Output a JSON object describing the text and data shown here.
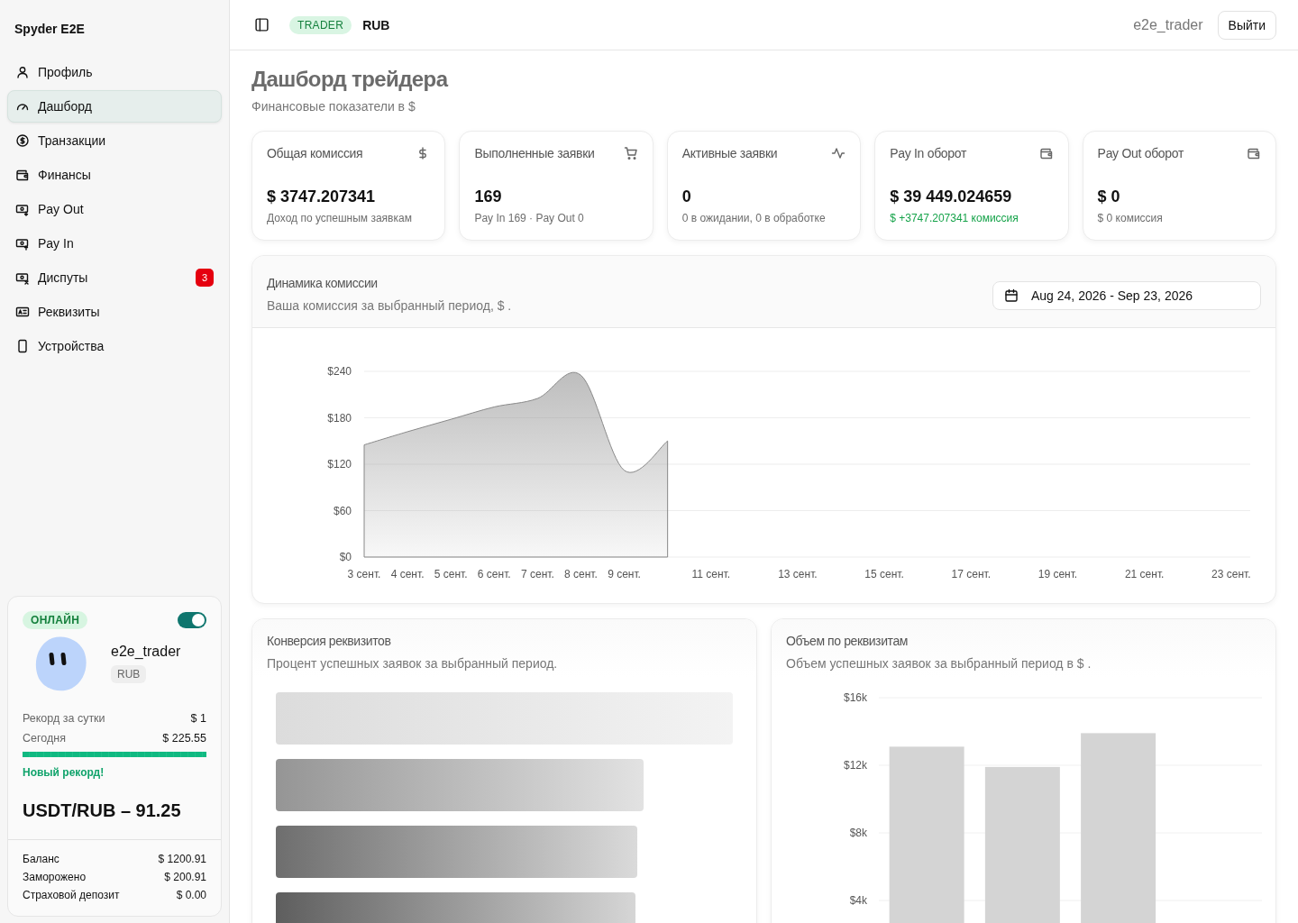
{
  "sidebar": {
    "brand": "Spyder E2E",
    "items": [
      {
        "label": "Профиль",
        "selected": false
      },
      {
        "label": "Дашборд",
        "selected": true
      },
      {
        "label": "Транзакции",
        "selected": false
      },
      {
        "label": "Финансы",
        "selected": false
      },
      {
        "label": "Pay Out",
        "selected": false
      },
      {
        "label": "Pay In",
        "selected": false
      },
      {
        "label": "Диспуты",
        "selected": false,
        "badge": "3"
      },
      {
        "label": "Реквизиты",
        "selected": false
      },
      {
        "label": "Устройства",
        "selected": false
      }
    ],
    "profile": {
      "status": "ОНЛАЙН",
      "on": true,
      "username": "e2e_trader",
      "currency": "RUB",
      "stats": [
        {
          "label": "Рекорд за сутки",
          "value": "$ 1"
        },
        {
          "label": "Сегодня",
          "value": "$ 225.55"
        }
      ],
      "record": {
        "level": 1,
        "message": "Новый рекорд!"
      },
      "rate": "USDT/RUB – 91.25",
      "balances": [
        {
          "label": "Баланс",
          "value": "$ 1200.91"
        },
        {
          "label": "Заморожено",
          "value": "$ 200.91"
        },
        {
          "label": "Страховой депозит",
          "value": "$ 0.00"
        }
      ]
    }
  },
  "header": {
    "role": "TRADER",
    "currency": "RUB",
    "username": "e2e_trader",
    "logout": "Выйти"
  },
  "page": {
    "title": "Дашборд трейдера",
    "subtitle": "Финансовые показатели в $"
  },
  "stats": [
    {
      "title": "Общая комиссия",
      "value": "$ 3747.207341",
      "note": "Доход по успешным заявкам",
      "positive": false
    },
    {
      "title": "Выполненные заявки",
      "value": "169",
      "note": "Pay In 169 · Pay Out 0",
      "positive": false
    },
    {
      "title": "Активные заявки",
      "value": "0",
      "note": "0 в ожидании, 0 в обработке",
      "positive": false
    },
    {
      "title": "Pay In оборот",
      "value": "$ 39 449.024659",
      "note": "$ +3747.207341 комиссия",
      "positive": true
    },
    {
      "title": "Pay Out оборот",
      "value": "$ 0",
      "note": "$ 0 комиссия",
      "positive": false
    }
  ],
  "commission": {
    "title": "Динамика комиссии",
    "subtitle": "Ваша комиссия за выбранный период, $ .",
    "date_range": "Aug 24, 2026 - Sep 23, 2026",
    "chart_data": {
      "type": "area",
      "x": [
        3,
        4,
        5,
        6,
        7,
        8,
        9,
        10
      ],
      "grid": true,
      "series": [
        {
          "color": "#888888",
          "values": [
            145,
            162,
            178,
            194,
            205,
            235,
            112,
            150
          ]
        }
      ],
      "xlim": [
        3,
        23.44
      ],
      "ylim": [
        0,
        240
      ],
      "yticks": [
        {
          "value": 0,
          "label": "$0"
        },
        {
          "value": 60,
          "label": "$60"
        },
        {
          "value": 120,
          "label": "$120"
        },
        {
          "value": 180,
          "label": "$180"
        },
        {
          "value": 240,
          "label": "$240"
        }
      ],
      "xticks": [
        {
          "value": 3,
          "label": "3 сент."
        },
        {
          "value": 4,
          "label": "4 сент."
        },
        {
          "value": 5,
          "label": "5 сент."
        },
        {
          "value": 6,
          "label": "6 сент."
        },
        {
          "value": 7,
          "label": "7 сент."
        },
        {
          "value": 8,
          "label": "8 сент."
        },
        {
          "value": 9,
          "label": "9 сент."
        },
        {
          "value": 11,
          "label": "11 сент."
        },
        {
          "value": 13,
          "label": "13 сент."
        },
        {
          "value": 15,
          "label": "15 сент."
        },
        {
          "value": 17,
          "label": "17 сент."
        },
        {
          "value": 19,
          "label": "19 сент."
        },
        {
          "value": 21,
          "label": "21 сент."
        },
        {
          "value": 23,
          "label": "23 сент."
        }
      ]
    }
  },
  "conversion": {
    "title": "Конверсия реквизитов",
    "subtitle": "Процент успешных заявок за выбранный период."
  },
  "volume": {
    "title": "Объем по реквизитам",
    "subtitle": "Объем успешных заявок за выбранный период в $ .",
    "chart_data": {
      "type": "bar",
      "values": [
        13100,
        11900,
        13900,
        null
      ],
      "ylim": [
        0,
        16000
      ],
      "grid": true,
      "yticks": [
        {
          "value": 4000,
          "label": "$4k"
        },
        {
          "value": 8000,
          "label": "$8k"
        },
        {
          "value": 12000,
          "label": "$12k"
        },
        {
          "value": 16000,
          "label": "$16k"
        }
      ]
    }
  }
}
